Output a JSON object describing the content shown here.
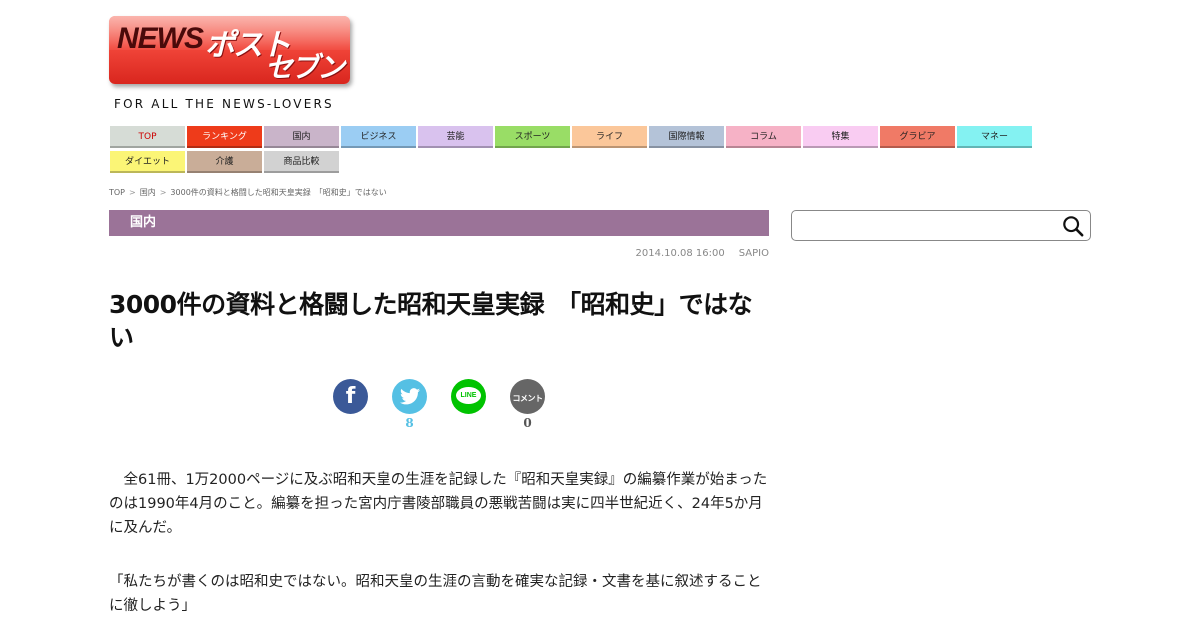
{
  "logo": {
    "news": "NEWS",
    "post": "ポスト",
    "seven": "セブン"
  },
  "tagline": "FOR ALL THE NEWS-LOVERS",
  "nav": [
    {
      "label": "TOP",
      "color": "#d6dcd6",
      "text": "#cc0000"
    },
    {
      "label": "ランキング",
      "color": "#ee3b1a",
      "text": "#ffffff"
    },
    {
      "label": "国内",
      "color": "#c9b4c9",
      "text": "#222222"
    },
    {
      "label": "ビジネス",
      "color": "#9bcdf3",
      "text": "#222222"
    },
    {
      "label": "芸能",
      "color": "#d9c2ee",
      "text": "#222222"
    },
    {
      "label": "スポーツ",
      "color": "#99dd66",
      "text": "#222222"
    },
    {
      "label": "ライフ",
      "color": "#fbc79a",
      "text": "#222222"
    },
    {
      "label": "国際情報",
      "color": "#b4c3d8",
      "text": "#222222"
    },
    {
      "label": "コラム",
      "color": "#f6b2c6",
      "text": "#222222"
    },
    {
      "label": "特集",
      "color": "#f9ccf2",
      "text": "#222222"
    },
    {
      "label": "グラビア",
      "color": "#f07a66",
      "text": "#222222"
    },
    {
      "label": "マネー",
      "color": "#84f2f2",
      "text": "#222222"
    },
    {
      "label": "ダイエット",
      "color": "#fbf576",
      "text": "#222222"
    },
    {
      "label": "介護",
      "color": "#c9ad98",
      "text": "#222222"
    },
    {
      "label": "商品比較",
      "color": "#d2d2d2",
      "text": "#222222"
    }
  ],
  "breadcrumb": [
    "TOP",
    "国内",
    "3000件の資料と格闘した昭和天皇実録　「昭和史」ではない"
  ],
  "category": "国内",
  "meta": {
    "date": "2014.10.08 16:00",
    "source": "SAPIO"
  },
  "article": {
    "title": "3000件の資料と格闘した昭和天皇実録　「昭和史」ではない",
    "paragraphs": [
      "　全61冊、1万2000ページに及ぶ昭和天皇の生涯を記録した『昭和天皇実録』の編纂作業が始まったのは1990年4月のこと。編纂を担った宮内庁書陵部職員の悪戦苦闘は実に四半世紀近く、24年5か月に及んだ。",
      "「私たちが書くのは昭和史ではない。昭和天皇の生涯の言動を確実な記録・文書を基に叙述することに徹しよう」"
    ]
  },
  "share": {
    "facebook": {
      "icon": "f",
      "color": "#3b5998"
    },
    "twitter": {
      "count": "8",
      "color": "#55c0e4"
    },
    "line": {
      "icon": "LINE",
      "color": "#00c300"
    },
    "comment": {
      "icon": "コメント",
      "count": "0",
      "color": "#666666"
    }
  },
  "search": {
    "placeholder": ""
  }
}
